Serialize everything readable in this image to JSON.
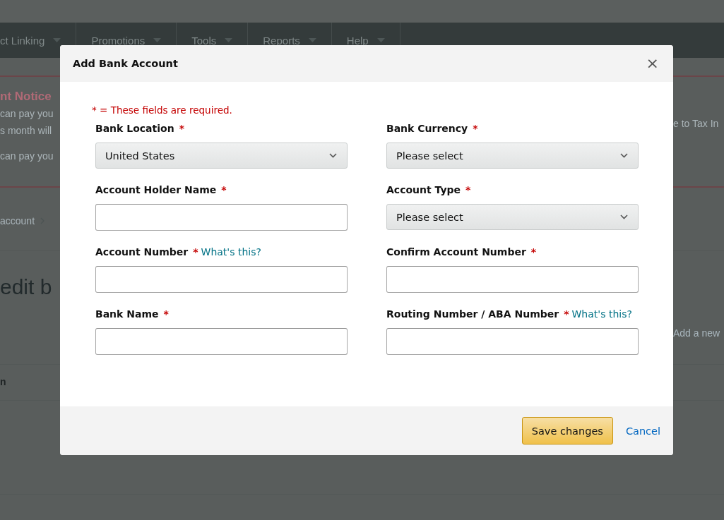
{
  "background": {
    "nav": [
      {
        "label": "ct Linking"
      },
      {
        "label": "Promotions"
      },
      {
        "label": "Tools"
      },
      {
        "label": "Reports"
      },
      {
        "label": "Help"
      }
    ],
    "notice": {
      "title": "nt Notice",
      "lines_left": [
        "can pay you",
        "s month will",
        "can pay you"
      ],
      "line_right": "e to Tax In"
    },
    "breadcrumb": "account",
    "heading": "edit b",
    "add_link": "Add a new",
    "table_header": "n"
  },
  "dialog": {
    "title": "Add Bank Account",
    "close": "×",
    "required_mark": "*",
    "required_note": "* = These fields are required.",
    "fields": [
      {
        "label": "Bank Location",
        "required": true,
        "kind": "select",
        "value": "United States"
      },
      {
        "label": "Bank Currency",
        "required": true,
        "kind": "select",
        "value": "Please select"
      },
      {
        "label": "Account Holder Name",
        "required": true,
        "kind": "text"
      },
      {
        "label": "Account Type",
        "required": true,
        "kind": "select",
        "value": "Please select"
      },
      {
        "label": "Account Number",
        "required": true,
        "kind": "text",
        "help_link": "What's this?"
      },
      {
        "label": "Confirm Account Number",
        "required": true,
        "kind": "text"
      },
      {
        "label": "Bank Name",
        "required": true,
        "kind": "text"
      },
      {
        "label": "Routing Number / ABA Number",
        "required": true,
        "kind": "text",
        "help_link": "What's this?"
      }
    ],
    "save_button": "Save changes",
    "cancel_link": "Cancel"
  }
}
